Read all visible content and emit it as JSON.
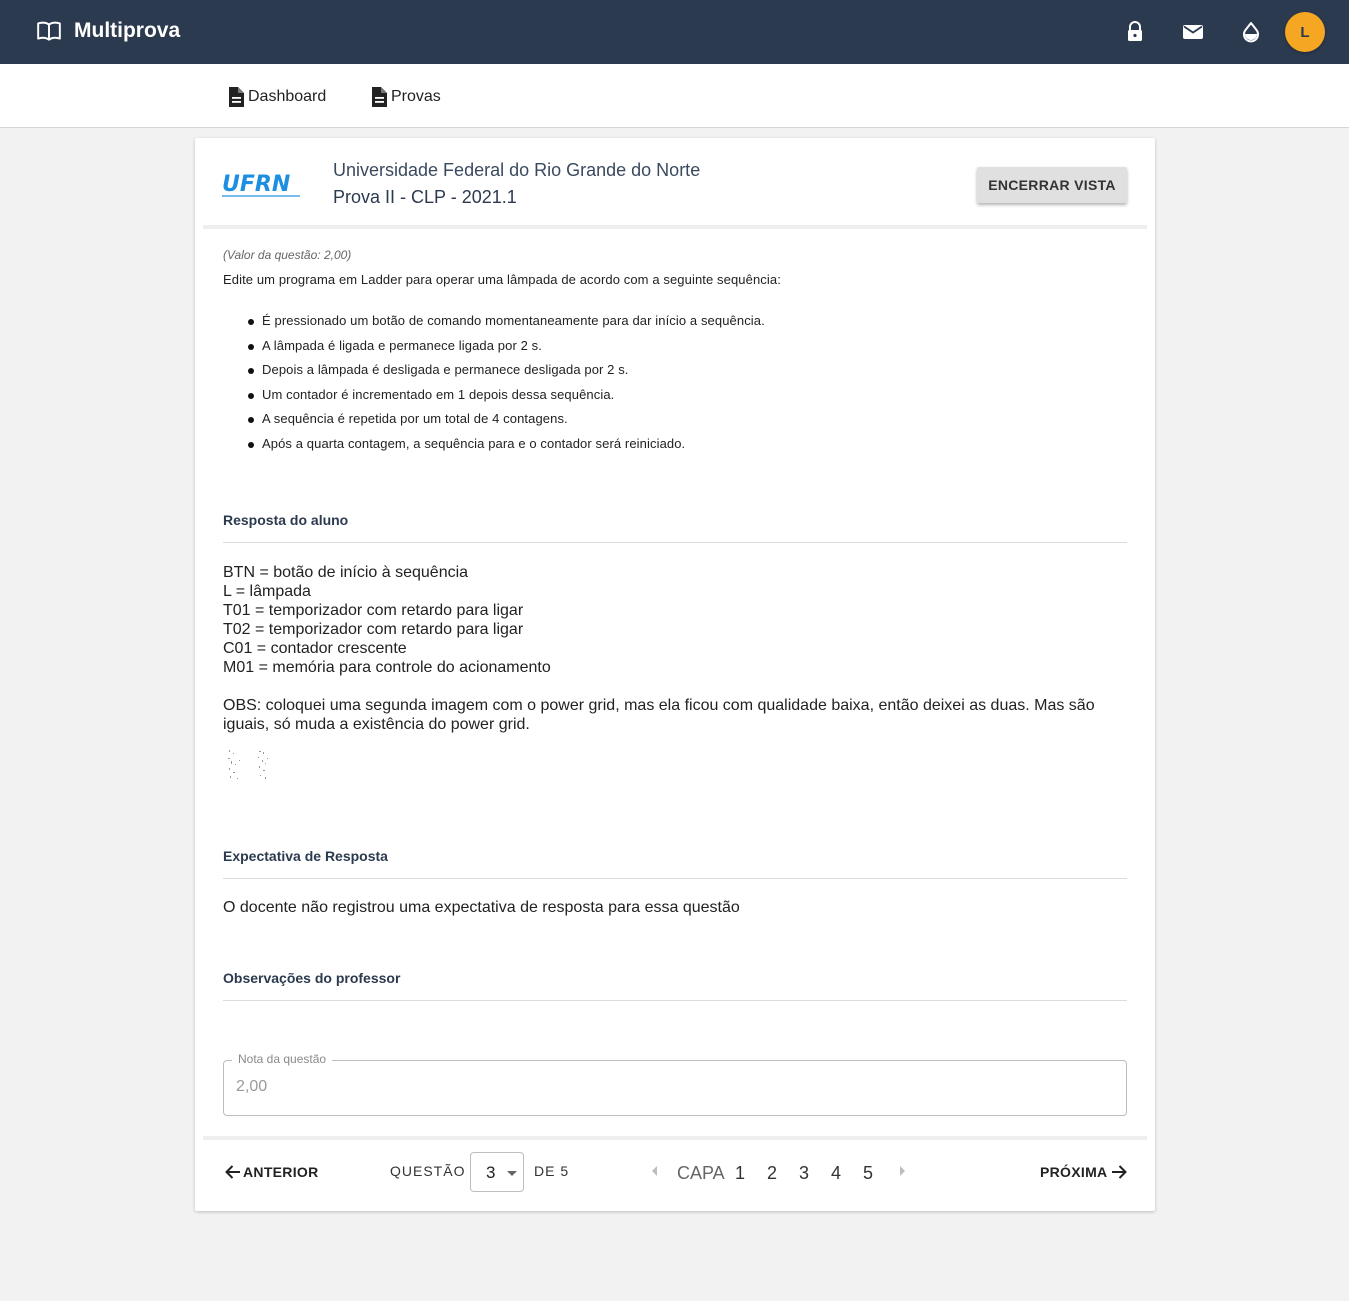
{
  "app": {
    "title": "Multiprova",
    "avatar_initial": "L",
    "header_color": "#2c3a4f",
    "accent_color": "#f5a623"
  },
  "header_icons": [
    "book-icon",
    "lock-icon",
    "mail-icon",
    "drop-icon"
  ],
  "nav": {
    "items": [
      {
        "label": "Dashboard",
        "icon": "document-icon"
      },
      {
        "label": "Provas",
        "icon": "document-icon"
      }
    ]
  },
  "exam": {
    "logo_text": "UFRN",
    "university": "Universidade Federal do Rio Grande do Norte",
    "name": "Prova II - CLP - 2021.1",
    "close_button": "ENCERRAR VISTA"
  },
  "question": {
    "value_label": "(Valor da questão: 2,00)",
    "text": "Edite um programa em Ladder para operar uma lâmpada de acordo com a seguinte sequência:",
    "items": [
      "É pressionado um botão de comando momentaneamente para dar início a sequência.",
      "A lâmpada é ligada e permanece ligada por 2 s.",
      "Depois a lâmpada é desligada e permanece desligada por 2 s.",
      "Um contador é incrementado em 1 depois dessa sequência.",
      "A sequência é repetida por um total de 4 contagens.",
      "Após a quarta contagem, a sequência para e o contador será reiniciado."
    ]
  },
  "answer": {
    "title": "Resposta do aluno",
    "lines": [
      "BTN = botão de início à sequência",
      "L = lâmpada",
      "T01 = temporizador com retardo para ligar",
      "T02 = temporizador com retardo para ligar",
      "C01 = contador crescente",
      "M01 = memória para controle do acionamento"
    ],
    "obs": "OBS: coloquei uma segunda imagem com o power grid, mas ela ficou com qualidade baixa, então deixei as duas. Mas são iguais, só muda a existência do power grid."
  },
  "expectation": {
    "title": "Expectativa de Resposta",
    "text": "O docente não registrou uma expectativa de resposta para essa questão"
  },
  "teacher_notes": {
    "title": "Observações do professor"
  },
  "grade": {
    "label": "Nota da questão",
    "value": "2,00"
  },
  "pager": {
    "prev": "ANTERIOR",
    "next": "PRÓXIMA",
    "question_label": "QUESTÃO",
    "current": "3",
    "of_label": "DE 5",
    "pages": [
      "CAPA",
      "1",
      "2",
      "3",
      "4",
      "5"
    ]
  }
}
